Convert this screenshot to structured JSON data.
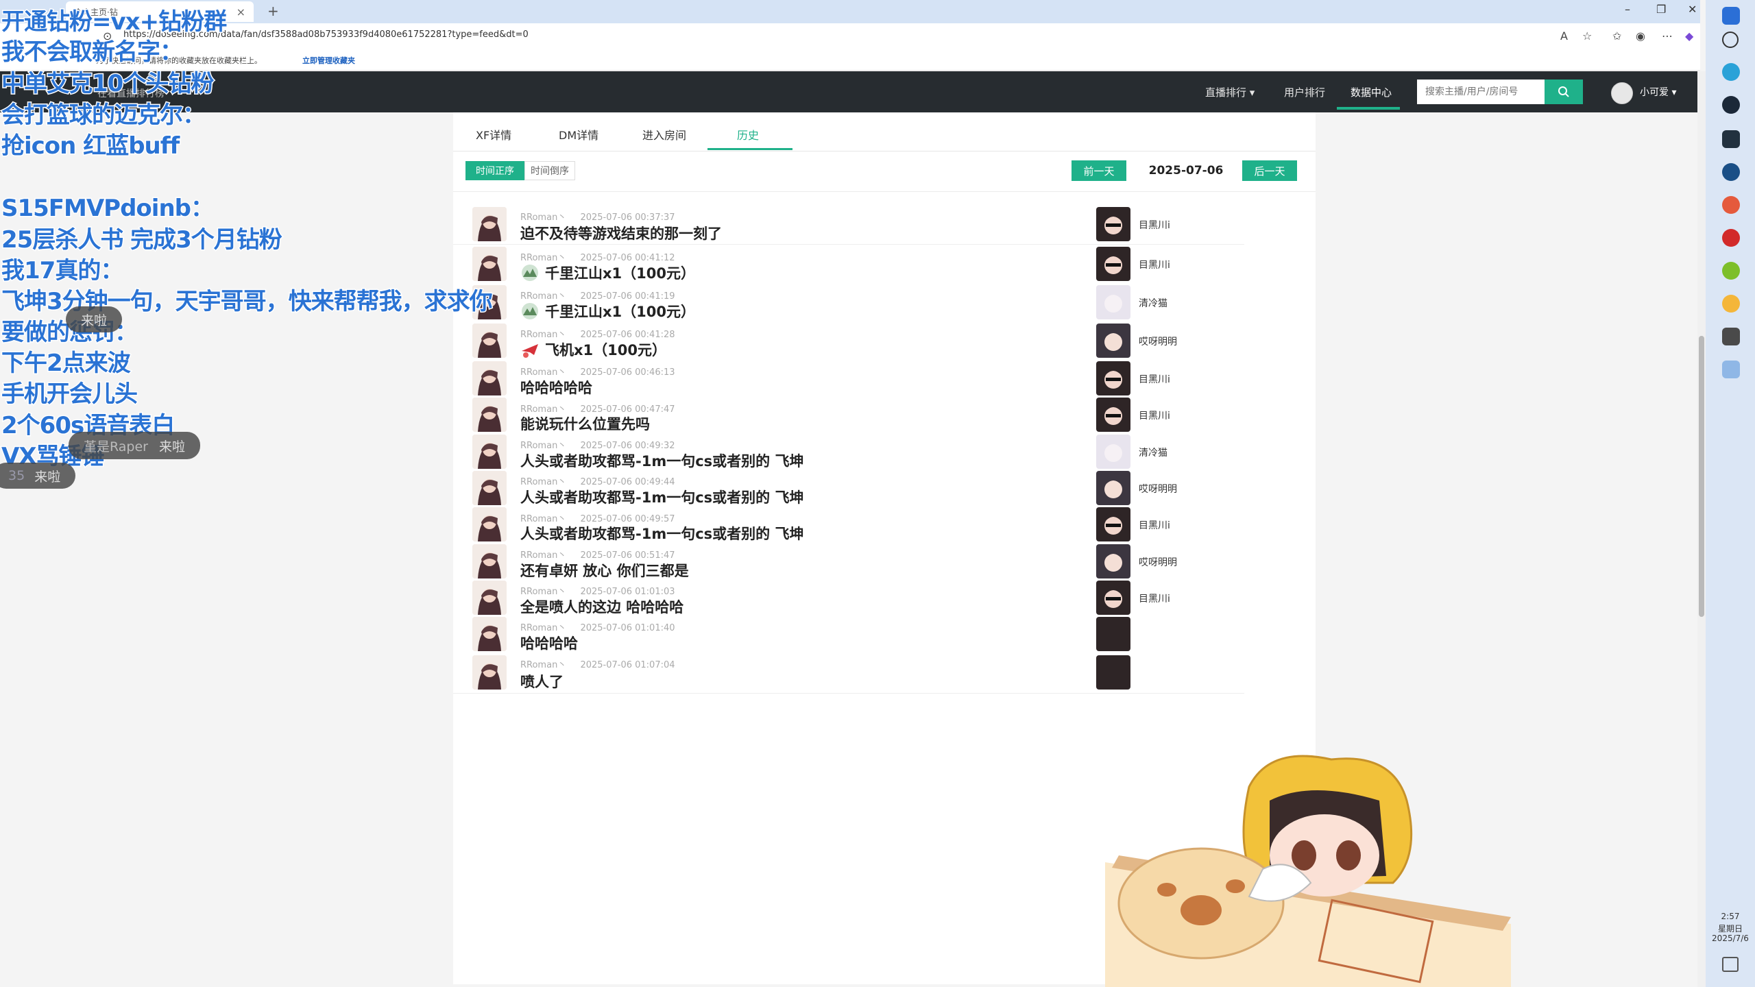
{
  "browser": {
    "tab_title": "个人主页·钻",
    "url": "https://doseeing.com/data/fan/dsf3588ad08b753933f9d4080e61752281?type=feed&dt=0",
    "favorites_text": "为了快速访问，请将你的收藏夹放在收藏夹栏上。",
    "favorites_link": "立即管理收藏夹"
  },
  "site_nav": {
    "items": [
      "直播排行 ▾",
      "用户排行",
      "数据中心"
    ],
    "search_placeholder": "搜索主播/用户/房间号",
    "user_name": "小可爱 ▾",
    "banner_text": "在看直播排行榜"
  },
  "tabs": [
    "XF详情",
    "DM详情",
    "进入房间",
    "历史"
  ],
  "active_tab": "历史",
  "toolbar": {
    "sort_asc": "时间正序",
    "sort_desc": "时间倒序",
    "prev": "前一天",
    "date": "2025-07-06",
    "next": "后一天"
  },
  "rows": [
    {
      "user": "RRoman丶",
      "time": "2025-07-06 00:37:37",
      "msg": "迫不及待等游戏结束的那一刻了",
      "gift": "",
      "anchor": "目黑川i",
      "face": "dark"
    },
    {
      "user": "RRoman丶",
      "time": "2025-07-06 00:41:12",
      "msg": "千里江山x1（100元）",
      "gift": "painting",
      "anchor": "目黑川i",
      "face": "dark"
    },
    {
      "user": "RRoman丶",
      "time": "2025-07-06 00:41:19",
      "msg": "千里江山x1（100元）",
      "gift": "painting",
      "anchor": "清冷猫",
      "face": "light"
    },
    {
      "user": "RRoman丶",
      "time": "2025-07-06 00:41:28",
      "msg": "飞机x1（100元）",
      "gift": "plane",
      "anchor": "哎呀明明",
      "face": "mid"
    },
    {
      "user": "RRoman丶",
      "time": "2025-07-06 00:46:13",
      "msg": "哈哈哈哈哈",
      "gift": "",
      "anchor": "目黑川i",
      "face": "dark"
    },
    {
      "user": "RRoman丶",
      "time": "2025-07-06 00:47:47",
      "msg": "能说玩什么位置先吗",
      "gift": "",
      "anchor": "目黑川i",
      "face": "dark"
    },
    {
      "user": "RRoman丶",
      "time": "2025-07-06 00:49:32",
      "msg": "人头或者助攻都骂-1m一句cs或者别的  飞坤",
      "gift": "",
      "anchor": "清冷猫",
      "face": "light"
    },
    {
      "user": "RRoman丶",
      "time": "2025-07-06 00:49:44",
      "msg": "人头或者助攻都骂-1m一句cs或者别的  飞坤",
      "gift": "",
      "anchor": "哎呀明明",
      "face": "mid"
    },
    {
      "user": "RRoman丶",
      "time": "2025-07-06 00:49:57",
      "msg": "人头或者助攻都骂-1m一句cs或者别的  飞坤",
      "gift": "",
      "anchor": "目黑川i",
      "face": "dark"
    },
    {
      "user": "RRoman丶",
      "time": "2025-07-06 00:51:47",
      "msg": "还有卓妍  放心  你们三都是",
      "gift": "",
      "anchor": "哎呀明明",
      "face": "mid"
    },
    {
      "user": "RRoman丶",
      "time": "2025-07-06 01:01:03",
      "msg": "全是喷人的这边  哈哈哈哈",
      "gift": "",
      "anchor": "目黑川i",
      "face": "dark"
    },
    {
      "user": "RRoman丶",
      "time": "2025-07-06 01:01:40",
      "msg": "哈哈哈哈",
      "gift": "",
      "anchor": "",
      "face": "dark"
    },
    {
      "user": "RRoman丶",
      "time": "2025-07-06 01:07:04",
      "msg": "喷人了",
      "gift": "",
      "anchor": "",
      "face": "dark"
    }
  ],
  "overlay_lines": [
    "开通钻粉=vx+钻粉群",
    "我不会取新名字：",
    "中单艾克10个头钻粉",
    "会打篮球的迈克尔：",
    "抢icon 红蓝buff",
    "",
    "S15FMVPdoinb：",
    " 25层杀人书 完成3个月钻粉",
    "我17真的：",
    "飞坤3分钟一句，天宇哥哥，快来帮帮我，求求你",
    "要做的惩罚：",
    "下午2点来波",
    "手机开会儿头",
    "2个60s语音表白",
    "VX骂锤锤"
  ],
  "chat_bubbles": [
    {
      "name": "",
      "text": "来啦"
    },
    {
      "name": "堇是Raper",
      "text": "来啦"
    },
    {
      "name": "35",
      "text": "来啦"
    }
  ],
  "clock": {
    "time": "2:57",
    "weekday": "星期日",
    "date": "2025/7/6"
  },
  "colors": {
    "accent": "#1fb18a",
    "header": "#272c30",
    "overlay": "#2a73d4"
  }
}
